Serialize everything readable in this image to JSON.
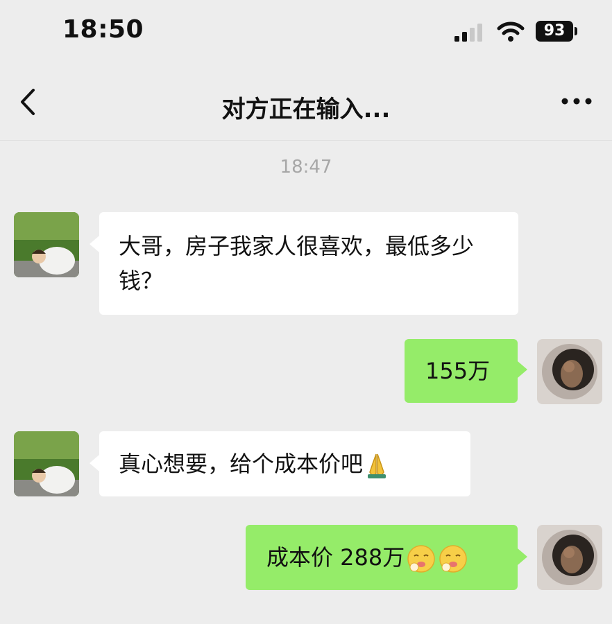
{
  "status_bar": {
    "time": "18:50",
    "battery": "93"
  },
  "nav": {
    "title": "对方正在输入..."
  },
  "chat": {
    "timestamp": "18:47",
    "messages": [
      {
        "side": "received",
        "text": "大哥，房子我家人很喜欢，最低多少钱？"
      },
      {
        "side": "sent",
        "text": "155万"
      },
      {
        "side": "received",
        "text": "真心想要，给个成本价吧",
        "emoji": "folded-hands-icon"
      },
      {
        "side": "sent",
        "text": "成本价 288万",
        "emoji": "tongue-out-face-icon"
      }
    ]
  },
  "colors": {
    "background": "#ededed",
    "sent_bubble": "#95ec69",
    "received_bubble": "#ffffff"
  }
}
